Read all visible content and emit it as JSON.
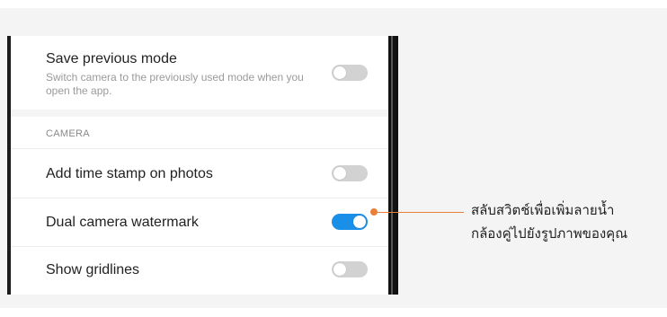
{
  "settings": {
    "save_previous_mode": {
      "title": "Save previous mode",
      "description": "Switch camera to the previously used mode when you open the app.",
      "enabled": false
    },
    "section_camera": "CAMERA",
    "add_time_stamp": {
      "title": "Add time stamp on photos",
      "enabled": false
    },
    "dual_camera_watermark": {
      "title": "Dual camera watermark",
      "enabled": true
    },
    "show_gridlines": {
      "title": "Show gridlines",
      "enabled": false
    }
  },
  "callout": {
    "line1": "สลับสวิตช์เพื่อเพิ่มลายน้ำ",
    "line2": "กล้องคู่ไปยังรูปภาพของคุณ"
  },
  "colors": {
    "toggle_on": "#1a8fe8",
    "toggle_off": "#d2d2d2",
    "callout_accent": "#e8803a"
  }
}
